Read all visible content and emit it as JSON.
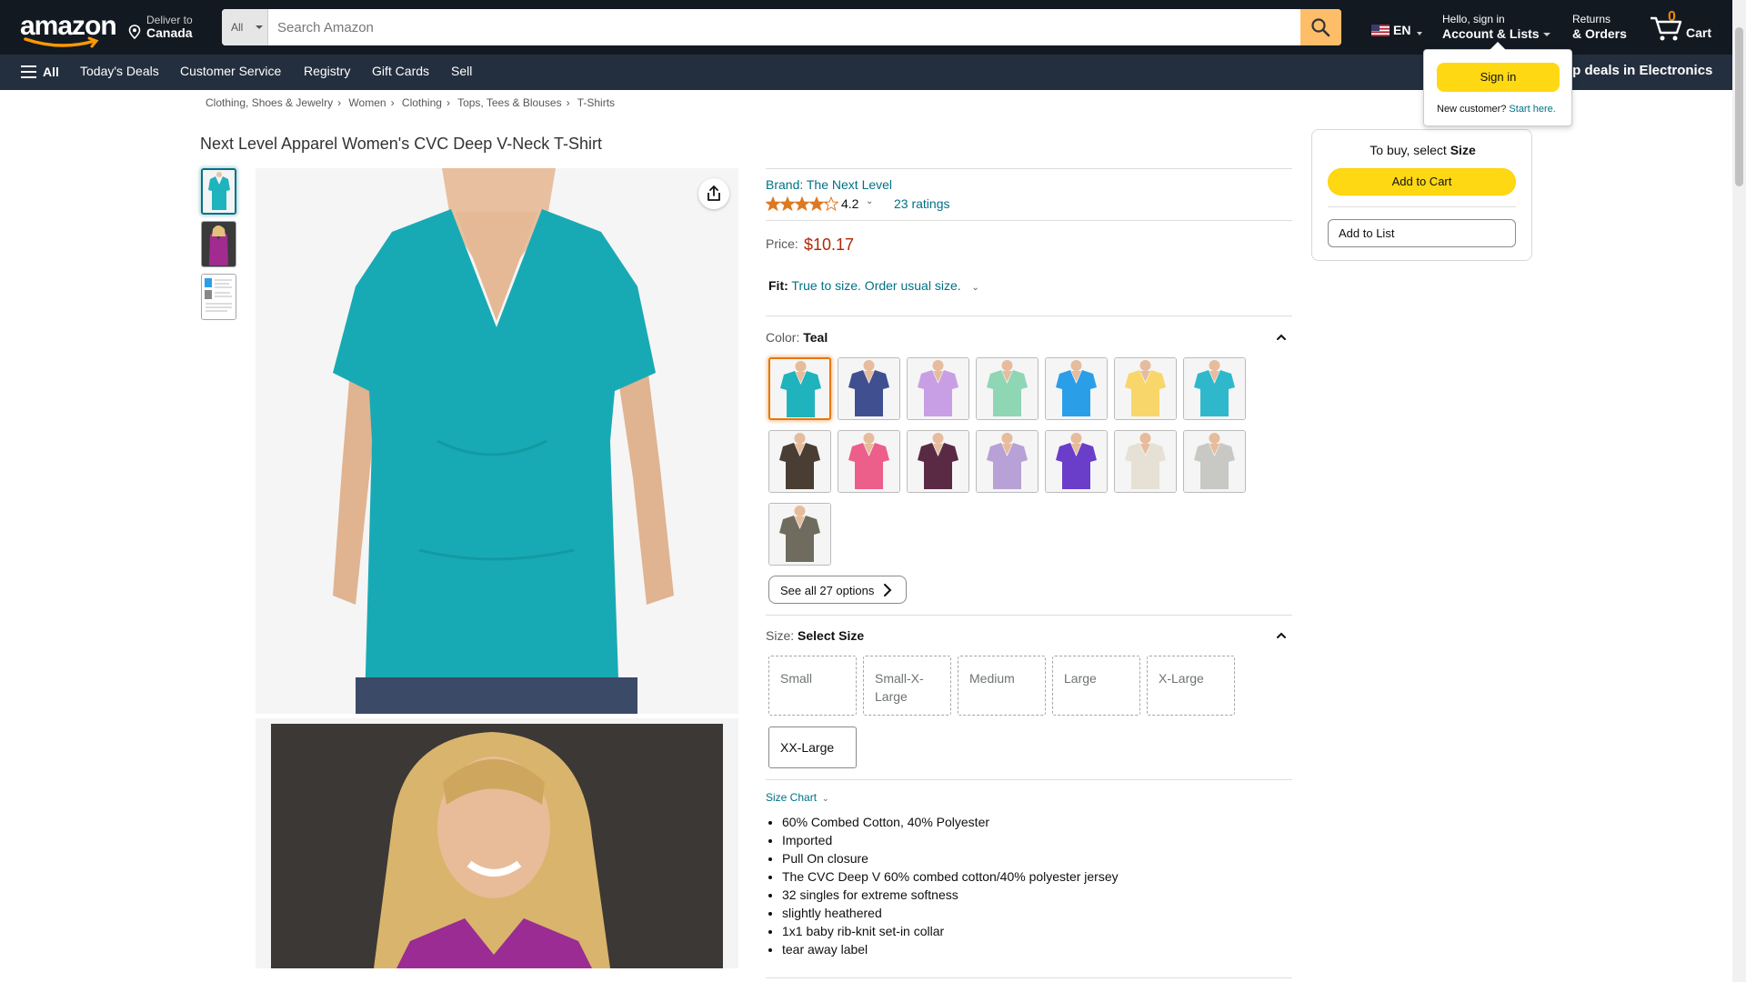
{
  "header": {
    "logo": "amazon",
    "deliver": {
      "line1": "Deliver to",
      "line2": "Canada"
    },
    "search": {
      "category": "All",
      "placeholder": "Search Amazon"
    },
    "language": "EN",
    "account": {
      "line1": "Hello, sign in",
      "line2": "Account & Lists"
    },
    "returns": {
      "line1": "Returns",
      "line2": "& Orders"
    },
    "cart": {
      "count": "0",
      "label": "Cart"
    }
  },
  "subnav": {
    "all_label": "All",
    "items": [
      "Today's Deals",
      "Customer Service",
      "Registry",
      "Gift Cards",
      "Sell"
    ],
    "promo": "op deals in Electronics"
  },
  "breadcrumb": [
    "Clothing, Shoes & Jewelry",
    "Women",
    "Clothing",
    "Tops, Tees & Blouses",
    "T-Shirts"
  ],
  "product": {
    "title": "Next Level Apparel Women's CVC Deep V-Neck T-Shirt",
    "brand": "Brand: The Next Level",
    "rating": "4.2",
    "ratings_count": "23 ratings",
    "price_label": "Price:",
    "price": "$10.17",
    "fit_label": "Fit:",
    "fit_text": "True to size. Order usual size.",
    "color_label": "Color:",
    "color_selected": "Teal",
    "see_all": "See all 27 options",
    "size_label": "Size:",
    "size_selected": "Select Size",
    "sizes": [
      "Small",
      "Small-X-Large",
      "Medium",
      "Large",
      "X-Large",
      "XX-Large"
    ],
    "size_chart": "Size Chart",
    "bullets": [
      "60% Combed Cotton, 40% Polyester",
      "Imported",
      "Pull On closure",
      "The CVC Deep V 60% combed cotton/40% polyester jersey",
      "32 singles for extreme softness",
      "slightly heathered",
      "1x1 baby rib-knit set-in collar",
      "tear away label"
    ]
  },
  "swatch_colors": [
    "#1fb3bd",
    "#3f4f8f",
    "#c89fe4",
    "#8fd6b4",
    "#2b9ee8",
    "#f9d66a",
    "#2fb8cc",
    "#4a3d33",
    "#ec5f8a",
    "#5a2a44",
    "#b8a1d6",
    "#6a3ec9",
    "#e6e1d4",
    "#c8c8c4",
    "#6f6c5f"
  ],
  "buybox": {
    "head_prefix": "To buy, select",
    "head_bold": "Size",
    "add_to_cart": "Add to Cart",
    "add_to_list": "Add to List"
  },
  "flyout": {
    "sign_in": "Sign in",
    "new_customer": "New customer?",
    "start_here": "Start here."
  },
  "colors": {
    "header_bg": "#131921",
    "subnav_bg": "#232f3e",
    "search_button": "#febd69",
    "cta_yellow": "#ffd814",
    "link": "#007185",
    "price": "#b12704"
  }
}
